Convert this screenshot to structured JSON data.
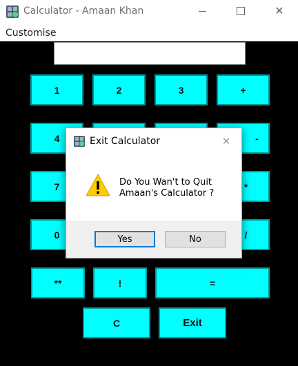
{
  "window": {
    "title": "Calculator - Amaan Khan"
  },
  "menu": {
    "customise": "Customise"
  },
  "display": {
    "value": ""
  },
  "buttons": {
    "one": "1",
    "two": "2",
    "three": "3",
    "plus": "+",
    "four": "4",
    "minus": "-",
    "seven": "7",
    "multiply": "*",
    "zero": "0",
    "divide": "/",
    "power": "**",
    "factorial": "!",
    "equals": "=",
    "clear": "C",
    "exit": "Exit"
  },
  "dialog": {
    "title": "Exit Calculator",
    "message": "Do You Wan't to Quit\nAmaan's Calculator ?",
    "yes": "Yes",
    "no": "No"
  },
  "colors": {
    "button_bg": "#00ffff",
    "background": "#000000",
    "dialog_focus": "#0078d7"
  }
}
